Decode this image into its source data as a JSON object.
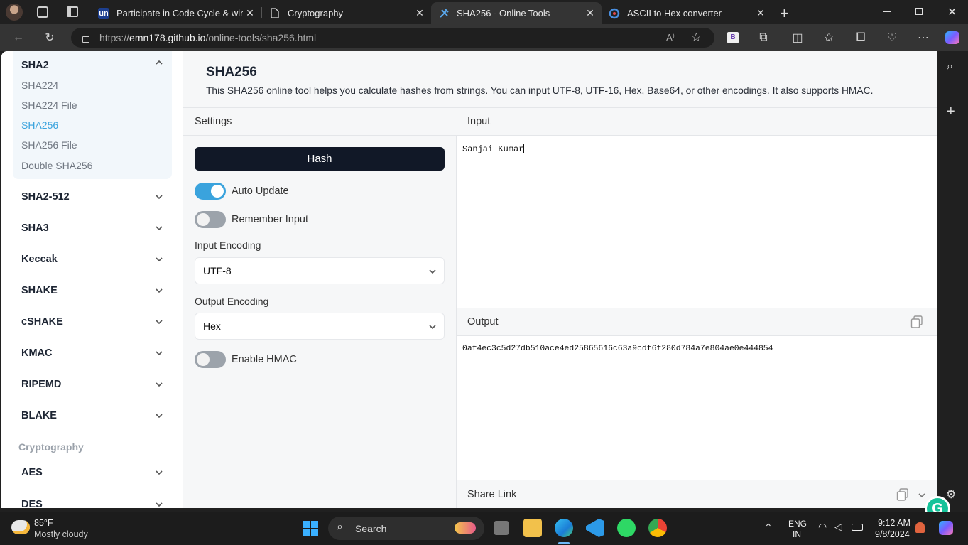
{
  "browser": {
    "tabs": [
      {
        "label": "Participate in Code Cycle & win e",
        "icon": "un",
        "active": false
      },
      {
        "label": "Cryptography",
        "icon": "page-icon",
        "active": false
      },
      {
        "label": "SHA256 - Online Tools",
        "icon": "tools-icon",
        "active": true
      },
      {
        "label": "ASCII to Hex converter",
        "icon": "gear-icon",
        "active": false
      }
    ],
    "url_prefix": "https://",
    "url_host": "emn178.github.io",
    "url_path": "/online-tools/sha256.html",
    "extension_badge": "B"
  },
  "sidebar": {
    "group_open": "SHA2",
    "sub_items": [
      {
        "label": "SHA224",
        "active": false
      },
      {
        "label": "SHA224 File",
        "active": false
      },
      {
        "label": "SHA256",
        "active": true
      },
      {
        "label": "SHA256 File",
        "active": false
      },
      {
        "label": "Double SHA256",
        "active": false
      }
    ],
    "groups": [
      "SHA2-512",
      "SHA3",
      "Keccak",
      "SHAKE",
      "cSHAKE",
      "KMAC",
      "RIPEMD",
      "BLAKE"
    ],
    "section_label": "Cryptography",
    "crypto_groups": [
      "AES",
      "DES"
    ]
  },
  "main": {
    "title": "SHA256",
    "description": "This SHA256 online tool helps you calculate hashes from strings. You can input UTF-8, UTF-16, Hex, Base64, or other encodings. It also supports HMAC.",
    "settings_label": "Settings",
    "input_label": "Input",
    "output_label": "Output",
    "share_label": "Share Link",
    "hash_button": "Hash",
    "auto_update_label": "Auto Update",
    "auto_update_on": true,
    "remember_input_label": "Remember Input",
    "remember_input_on": false,
    "input_encoding_label": "Input Encoding",
    "input_encoding_value": "UTF-8",
    "output_encoding_label": "Output Encoding",
    "output_encoding_value": "Hex",
    "hmac_label": "Enable HMAC",
    "hmac_on": false,
    "input_value": "Sanjai Kumar",
    "output_value": "0af4ec3c5d27db510ace4ed25865616c63a9cdf6f280d784a7e804ae0e444854"
  },
  "taskbar": {
    "weather_temp": "85°F",
    "weather_desc": "Mostly cloudy",
    "search_label": "Search",
    "lang_line1": "ENG",
    "lang_line2": "IN",
    "time": "9:12 AM",
    "date": "9/8/2024"
  },
  "colors": {
    "accent": "#3aa3dd",
    "hash_button_bg": "#111827"
  }
}
